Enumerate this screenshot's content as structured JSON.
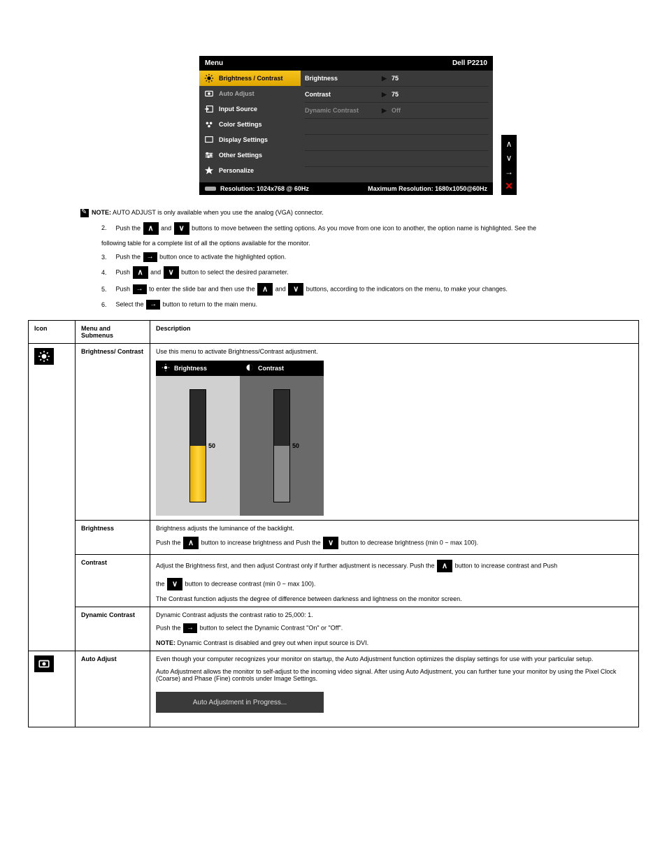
{
  "osd": {
    "title": "Menu",
    "model": "Dell P2210",
    "left_items": [
      {
        "label": "Brightness / Contrast",
        "active": true
      },
      {
        "label": "Auto Adjust"
      },
      {
        "label": "Input Source"
      },
      {
        "label": "Color Settings"
      },
      {
        "label": "Display Settings"
      },
      {
        "label": "Other Settings"
      },
      {
        "label": "Personalize"
      }
    ],
    "right_rows": [
      {
        "label": "Brightness",
        "value": "75"
      },
      {
        "label": "Contrast",
        "value": "75"
      },
      {
        "label": "Dynamic Contrast",
        "value": "Off",
        "disabled": true
      }
    ],
    "resolution": "Resolution: 1024x768 @ 60Hz",
    "max_resolution": "Maximum Resolution: 1680x1050@60Hz"
  },
  "note": {
    "bold": "NOTE:",
    "text": "AUTO ADJUST is only available when you use the analog (VGA) connector."
  },
  "steps": {
    "s2a": "Push the",
    "s2b": "and",
    "s2c": "buttons to move between the setting options. As you move from one icon to another, the option name is highlighted. See the",
    "s2d": "following table for a complete list of all the options available for the monitor.",
    "s3a": "Push the",
    "s3b": "button once to activate the highlighted option.",
    "s4a": "Push",
    "s4b": "and",
    "s4c": "button to select the desired parameter.",
    "s5a": "Push",
    "s5b": "to enter the slide bar and then use the",
    "s5c": "and",
    "s5d": "buttons, according to the indicators on the menu, to make your changes.",
    "s6a": "Select the",
    "s6b": "button to return to the main menu."
  },
  "table": {
    "headers": {
      "icon": "Icon",
      "menu": "Menu and Submenus",
      "desc": "Description"
    },
    "rows": {
      "bc": {
        "menu": "Brightness/ Contrast",
        "desc_intro": "Use this menu to activate Brightness/Contrast adjustment.",
        "brightness_hdr": "Brightness",
        "contrast_hdr": "Contrast",
        "slider_value": "50",
        "brightness_row": {
          "label": "Brightness",
          "line1": "Brightness adjusts the luminance of the backlight.",
          "line2a": "Push the",
          "line2b": "button to increase brightness and Push the",
          "line2c": "button to decrease brightness (min 0 ~ max 100)."
        },
        "contrast_row": {
          "label": "Contrast",
          "line1a": "Adjust the Brightness first, and then adjust Contrast only if further adjustment is necessary. Push the",
          "line1b": "button to increase contrast and Push",
          "line1c": "the",
          "line1d": "button to decrease contrast (min 0 ~ max 100).",
          "line2": "The Contrast function adjusts the degree of difference between darkness and lightness on the monitor screen."
        },
        "dyn_row": {
          "label": "Dynamic Contrast",
          "line1": "Dynamic Contrast adjusts the contrast ratio to 25,000: 1.",
          "line2a": "Push the",
          "line2b": "button to select the Dynamic Contrast \"On\" or \"Off\".",
          "note_bold": "NOTE:",
          "note_text": "Dynamic Contrast is disabled and grey out when input source is DVI."
        }
      },
      "auto": {
        "menu": "Auto Adjust",
        "line1": "Even though your computer recognizes your monitor on startup, the Auto Adjustment function optimizes the display settings for use with your particular setup.",
        "line2": "Auto Adjustment allows the monitor to self-adjust to the incoming video signal. After using Auto Adjustment, you can further tune your monitor by using the Pixel Clock (Coarse) and Phase (Fine) controls under Image Settings.",
        "progress": "Auto Adjustment in Progress..."
      }
    }
  }
}
